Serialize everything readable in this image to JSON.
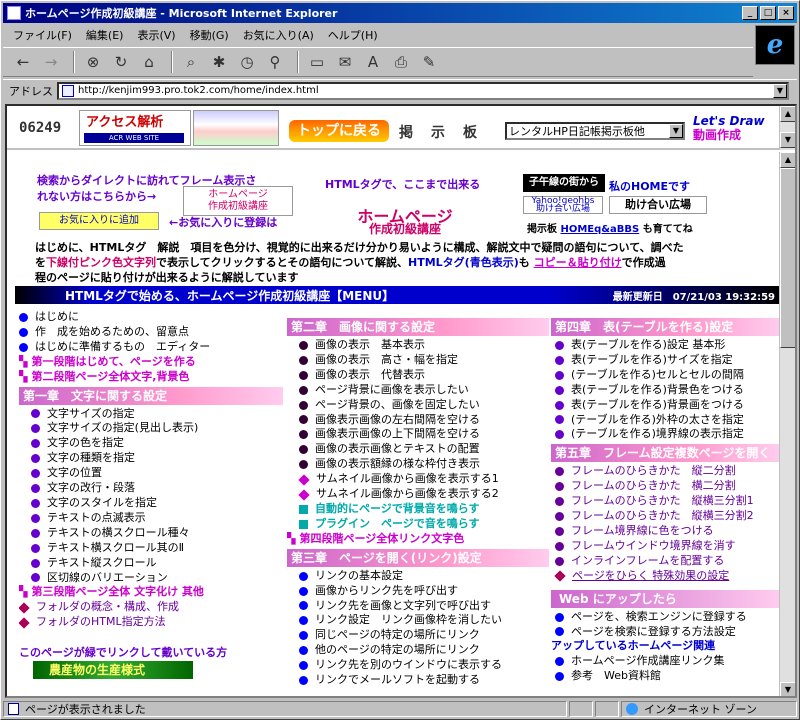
{
  "window": {
    "title": "ホームページ作成初級講座 - Microsoft Internet Explorer",
    "min": "_",
    "max": "□",
    "close": "×"
  },
  "menu": [
    "ファイル(F)",
    "編集(E)",
    "表示(V)",
    "移動(G)",
    "お気に入り(A)",
    "ヘルプ(H)"
  ],
  "toolbar": {
    "back": "←",
    "fwd": "→",
    "stop": "⊗",
    "refresh": "↻",
    "home": "⌂",
    "search": "⌕",
    "fav": "✱",
    "hist": "◷",
    "channels": "⚲",
    "full": "▭",
    "mail": "✉",
    "font": "A",
    "print": "⎙",
    "edit": "✎"
  },
  "address": {
    "label": "アドレス",
    "url": "http://kenjim993.pro.tok2.com/home/index.html"
  },
  "topframe": {
    "counter": "06249",
    "access_title": "アクセス解析",
    "access_sub": "ACR WEB SITE",
    "top_button": "トップに戻る",
    "keijiban": "掲示板",
    "select_value": "レンタルHP日記帳掲示板他",
    "letsdraw": "Let's Draw",
    "letsdraw_sub": "動画作成"
  },
  "header": {
    "direct1": "検索からダイレクトに訪れてフレーム表示さ",
    "direct2": "れない方はこちらから→",
    "home_btn1": "ホームページ",
    "home_btn2": "作成初級講座",
    "htmltag": "HTMLタグで、ここまで出来る",
    "machi": "子午線の街から",
    "myhome": "私のHOMEです",
    "fav_btn": "お気に入りに追加",
    "fav_text": "←お気に入りに登録は",
    "logo1": "ホームページ",
    "logo2": "作成初級講座",
    "yahoo1": "Yahoo!geohbs",
    "yahoo2": "助け合い広場",
    "tasuke": "助け合い広場",
    "bbs_a": "掲示板 ",
    "bbs_link": "HOMEq&aBBS",
    "bbs_b": " も育ててね"
  },
  "intro": {
    "p1": "はじめに、HTMLタグ　解説　項目を色分け、視覚的に出来るだけ分かり易いように構成、解説文中で疑問の語句について、調べた",
    "p2a": "を",
    "p2hl": "下線付ピンク色文字列",
    "p2b": "で表示してクリックするとその語句について解説、",
    "p2bl": "HTMLタグ(青色表示)",
    "p2c": "も ",
    "p2lk": "コピー＆貼り付け",
    "p2d": "で作成過",
    "p3": "程のページに貼り付けが出来るように解説しています"
  },
  "banner": {
    "title": "HTMLタグで始める、ホームページ作成初級講座【MENU】",
    "updated": "最新更新日　07/21/03 19:32:59"
  },
  "col1": {
    "top": [
      {
        "t": "はじめに",
        "k": "dot b"
      },
      {
        "t": "作　成を始めるための、留意点",
        "k": "dot b"
      },
      {
        "t": "はじめに準備するもの　エディター",
        "k": "dot b"
      }
    ],
    "steps": [
      "第一段階はじめて、ページを作る",
      "第二段階ページ全体文字,背景色"
    ],
    "sec1": "第一章　文字に関する設定",
    "items": [
      "文字サイズの指定",
      "文字サイズの指定(見出し表示)",
      "文字の色を指定",
      "文字の種類を指定",
      "文字の位置",
      "文字の改行・段落",
      "文字のスタイルを指定",
      "テキストの点滅表示",
      "テキストの横スクロール種々",
      "テキスト横スクロール其のⅡ",
      "テキスト縦スクロール",
      "区切線のバリエーション"
    ],
    "step3": "第三段階ページ全体 文字化け 其他",
    "folder": [
      "フォルダの概念・構成、作成",
      "フォルダのHTML指定方法"
    ],
    "green": "このページが緑でリンクして戴いている方",
    "banner2": "農産物の生産様式"
  },
  "col2": {
    "sec2": "第二章　画像に関する設定",
    "items": [
      "画像の表示　基本表示",
      "画像の表示　高さ・幅を指定",
      "画像の表示　代替表示",
      "ページ背景に画像を表示したい",
      "ページ背景の、画像を固定したい",
      "画像表示画像の左右間隔を空ける",
      "画像表示画像の上下間隔を空ける",
      "画像の表示画像とテキストの配置",
      "画像の表示額縁の様な枠付き表示"
    ],
    "thumbs": [
      "サムネイル画像から画像を表示する1",
      "サムネイル画像から画像を表示する2"
    ],
    "sound": [
      "自動的にページで背景音を鳴らす",
      "プラグイン　ページで音を鳴らす"
    ],
    "step4": "第四段階ページ全体リンク文字色",
    "sec3": "第三章　ページを開く(リンク)設定",
    "links": [
      "リンクの基本設定",
      "画像からリンク先を呼び出す",
      "リンク先を画像と文字列で呼び出す",
      "リンク設定　リンク画像枠を消したい",
      "同じページの特定の場所にリンク",
      "他のページの特定の場所にリンク",
      "リンク先を別のウインドウに表示する",
      "リンクでメールソフトを起動する"
    ]
  },
  "col3": {
    "sec4": "第四章　表(テーブルを作る)設定",
    "items": [
      "表(テーブルを作る)設定 基本形",
      "表(テーブルを作る)サイズを指定",
      "(テーブルを作る)セルとセルの間隔",
      "表(テーブルを作る)背景色をつける",
      "表(テーブルを作る)背景画をつける",
      "(テーブルを作る)外枠の太さを指定",
      "(テーブルを作る)境界線の表示指定"
    ],
    "sec5": "第五章　フレーム設定複数ページを開く",
    "frames": [
      "フレームのひらきかた　縦二分割",
      "フレームのひらきかた　横二分割",
      "フレームのひらきかた　縦横三分割1",
      "フレームのひらきかた　縦横三分割2",
      "フレーム境界線に色をつける",
      "フレームウインドウ境界線を消す",
      "インラインフレームを配置する"
    ],
    "special": "ページをひらく 特殊効果の設定",
    "web": "Web にアップしたら",
    "web_items": [
      "ページを、検索エンジンに登録する",
      "ページを検索に登録する方法設定"
    ],
    "upped": "アップしているホームページ関連",
    "upped_items": [
      "ホームページ作成講座リンク集",
      "参考　Web資料館"
    ]
  },
  "status": {
    "text": "ページが表示されました",
    "zone": "インターネット ゾーン"
  }
}
